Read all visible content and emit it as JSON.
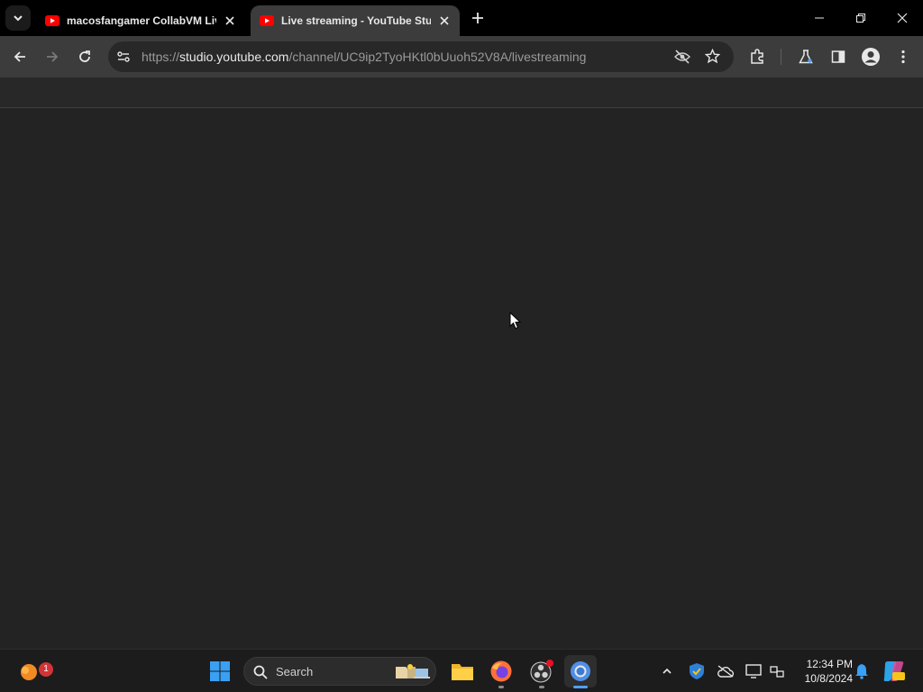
{
  "browser": {
    "tabs": [
      {
        "title": "macosfangamer CollabVM Live",
        "active": false
      },
      {
        "title": "Live streaming - YouTube Studio",
        "active": true
      }
    ],
    "url": {
      "scheme": "https://",
      "host": "studio.youtube.com",
      "path": "/channel/UC9ip2TyoHKtl0bUuoh52V8A/livestreaming"
    }
  },
  "taskbar": {
    "search_placeholder": "Search",
    "notification_count": "1",
    "time": "12:34 PM",
    "date": "10/8/2024"
  },
  "colors": {
    "tab_strip": "#000000",
    "toolbar": "#3c3c3c",
    "page_background": "#232323",
    "youtube_red": "#ff0000",
    "accent_blue": "#4ea1ff"
  }
}
